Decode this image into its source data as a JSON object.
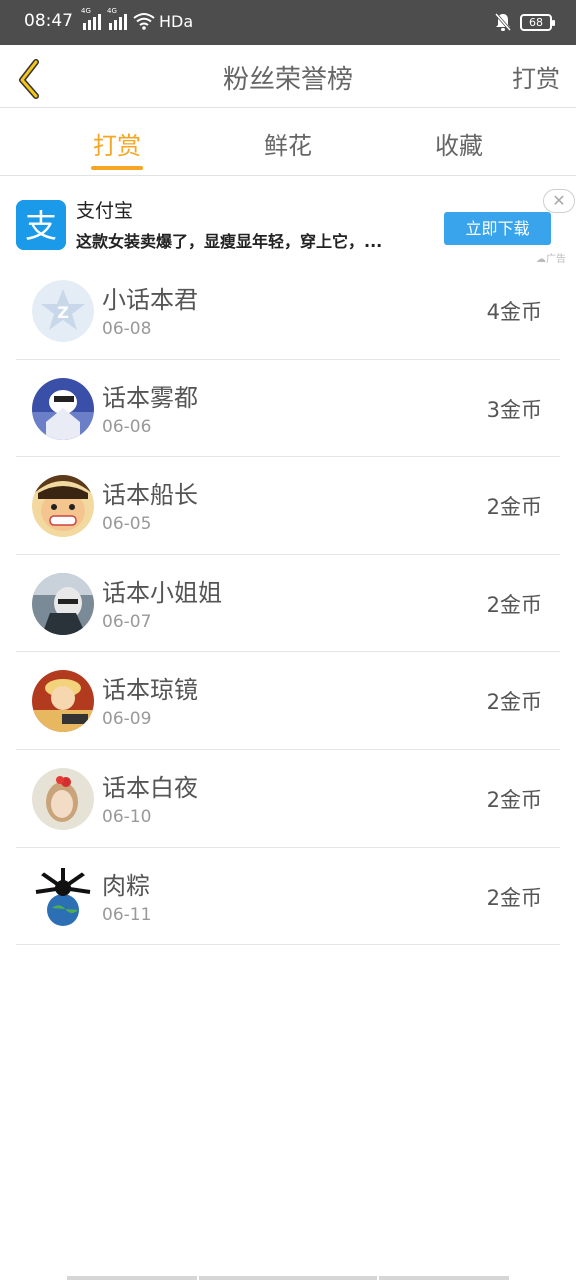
{
  "status_bar": {
    "time": "08:47",
    "net1": "4G",
    "net2": "4G",
    "hd": "HDa",
    "battery": "68"
  },
  "nav": {
    "title": "粉丝荣誉榜",
    "action": "打赏",
    "back_icon": "chevron-left-icon"
  },
  "tabs": [
    {
      "label": "打赏",
      "active": true
    },
    {
      "label": "鲜花",
      "active": false
    },
    {
      "label": "收藏",
      "active": false
    }
  ],
  "ad": {
    "title": "支付宝",
    "desc": "这款女装卖爆了，显瘦显年轻，穿上它，...",
    "button": "立即下载",
    "close": "✕",
    "tag": "广告"
  },
  "fans": [
    {
      "name": "小话本君",
      "date": "06-08",
      "value": "4金币",
      "avatar": "default-star-avatar"
    },
    {
      "name": "话本雾都",
      "date": "06-06",
      "value": "3金币",
      "avatar": "anime-avatar"
    },
    {
      "name": "话本船长",
      "date": "06-05",
      "value": "2金币",
      "avatar": "luffy-avatar"
    },
    {
      "name": "话本小姐姐",
      "date": "06-07",
      "value": "2金币",
      "avatar": "photo-avatar"
    },
    {
      "name": "话本琼镜",
      "date": "06-09",
      "value": "2金币",
      "avatar": "character-avatar"
    },
    {
      "name": "话本白夜",
      "date": "06-10",
      "value": "2金币",
      "avatar": "girl-avatar"
    },
    {
      "name": "肉粽",
      "date": "06-11",
      "value": "2金币",
      "avatar": "globe-avatar"
    }
  ]
}
